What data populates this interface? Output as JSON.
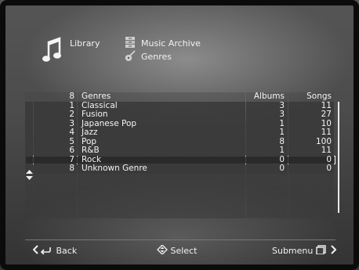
{
  "header": {
    "breadcrumb_root": "Library",
    "breadcrumb_1": "Music Archive",
    "breadcrumb_2": "Genres"
  },
  "table": {
    "header": {
      "num": "8",
      "name": "Genres",
      "albums": "Albums",
      "songs": "Songs"
    },
    "rows": [
      {
        "num": "1",
        "name": "Classical",
        "albums": "3",
        "songs": "11"
      },
      {
        "num": "2",
        "name": "Fusion",
        "albums": "3",
        "songs": "27"
      },
      {
        "num": "3",
        "name": "Japanese Pop",
        "albums": "1",
        "songs": "10"
      },
      {
        "num": "4",
        "name": "Jazz",
        "albums": "1",
        "songs": "11"
      },
      {
        "num": "5",
        "name": "Pop",
        "albums": "8",
        "songs": "100"
      },
      {
        "num": "6",
        "name": "R&B",
        "albums": "1",
        "songs": "11"
      },
      {
        "num": "7",
        "name": "Rock",
        "albums": "0",
        "songs": "0"
      },
      {
        "num": "8",
        "name": "Unknown Genre",
        "albums": "0",
        "songs": "0"
      }
    ],
    "selected_index": 6
  },
  "footer": {
    "back_label": "Back",
    "select_label": "Select",
    "submenu_label": "Submenu"
  },
  "colors": {
    "accent": "#f0f0f0",
    "row_bg": "#3a3a3a",
    "frame": "#0b0b0b"
  },
  "icons": {
    "library": "music-notes-icon",
    "archive": "archive-icon",
    "genres": "guitar-icon"
  }
}
